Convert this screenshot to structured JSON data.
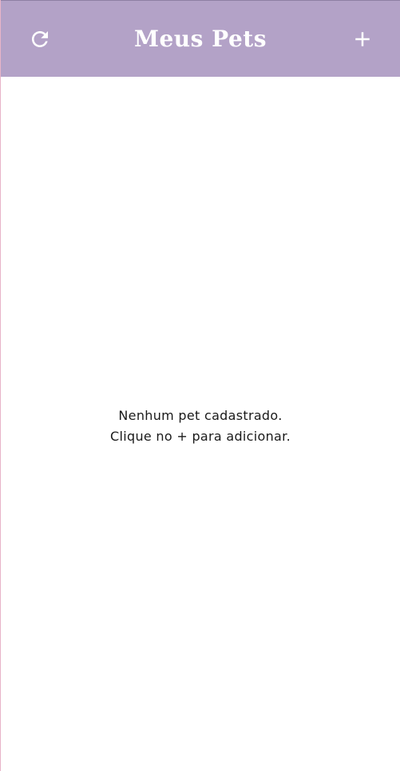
{
  "appbar": {
    "title": "Meus Pets",
    "background_color": "#b3a2c7",
    "refresh_icon": "refresh-icon",
    "add_icon": "plus-icon"
  },
  "empty_state": {
    "line1": "Nenhum pet cadastrado.",
    "line2": "Clique no + para adicionar."
  }
}
